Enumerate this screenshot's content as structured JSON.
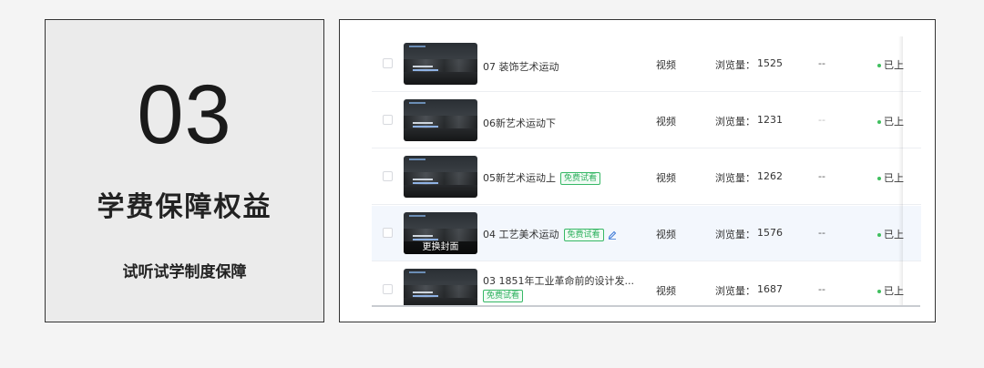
{
  "feature": {
    "number": "03",
    "title": "学费保障权益",
    "subtitle": "试听试学制度保障"
  },
  "columns": {
    "views_label": "浏览量："
  },
  "rows": [
    {
      "title": "07 装饰艺术运动",
      "type": "视频",
      "views": "1525",
      "col": "--",
      "status": "已上",
      "tag": "",
      "overlay": ""
    },
    {
      "title": "06新艺术运动下",
      "type": "视频",
      "views": "1231",
      "col": "--",
      "status": "已上",
      "tag": "",
      "overlay": ""
    },
    {
      "title": "05新艺术运动上",
      "type": "视频",
      "views": "1262",
      "col": "--",
      "status": "已上",
      "tag": "免费试看",
      "overlay": ""
    },
    {
      "title": "04 工艺美术运动",
      "type": "视频",
      "views": "1576",
      "col": "--",
      "status": "已上",
      "tag": "免费试看",
      "overlay": "更换封面"
    },
    {
      "title": "03 1851年工业革命前的设计发...",
      "type": "视频",
      "views": "1687",
      "col": "--",
      "status": "已上",
      "tag": "免费试看",
      "overlay": ""
    }
  ],
  "colors": {
    "tag_green": "#2fb15f",
    "status_green": "#3fbf5e",
    "highlight_row": "#f3f7fd"
  }
}
